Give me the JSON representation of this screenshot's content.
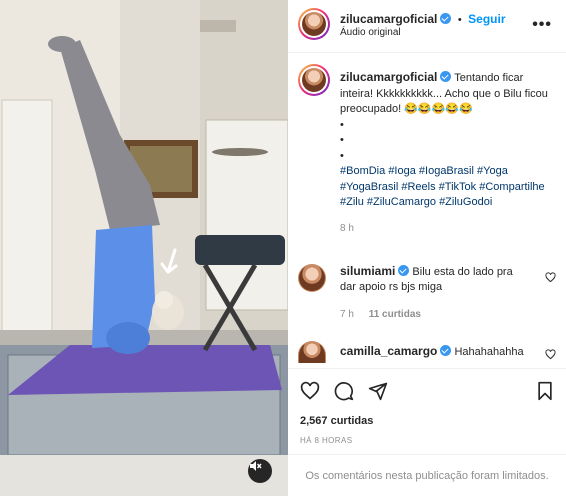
{
  "post": {
    "username": "zilucamargoficial",
    "follow_label": "Seguir",
    "audio": "Áudio original",
    "more_label": "•••",
    "caption_text": "Tentando ficar inteira! Kkkkkkkkkk... Acho que o Bilu ficou preocupado! 😂😂😂😂😂",
    "bullets": [
      "•",
      "•",
      "•"
    ],
    "hashtags": [
      "#BomDia",
      "#Ioga",
      "#IogaBrasil",
      "#Yoga",
      "#YogaBrasil",
      "#Reels",
      "#TikTok",
      "#Compartilhe",
      "#Zilu",
      "#ZiluCamargo",
      "#ZiluGodoi"
    ],
    "caption_time": "8 h",
    "likes": "2,567 curtidas",
    "posted_ago": "HÁ 8 HORAS",
    "comments_limited": "Os comentários nesta publicação foram limitados."
  },
  "comments": [
    {
      "username": "silumiami",
      "text": "Bilu esta do lado pra dar apoio rs bjs miga",
      "time": "7 h",
      "likes": "11 curtidas"
    },
    {
      "username": "camilla_camargo",
      "text": "Hahahahahha"
    }
  ],
  "icons": {
    "verified": "verified-badge-icon",
    "heart": "heart-icon",
    "comment": "comment-icon",
    "share": "share-icon",
    "save": "bookmark-icon",
    "mute": "muted-speaker-icon"
  },
  "colors": {
    "link": "#0095f6",
    "hashtag": "#00376b",
    "muted_text": "#8e8e8e",
    "mat": "#6d55b5",
    "outfit": "#5b8fe8"
  }
}
